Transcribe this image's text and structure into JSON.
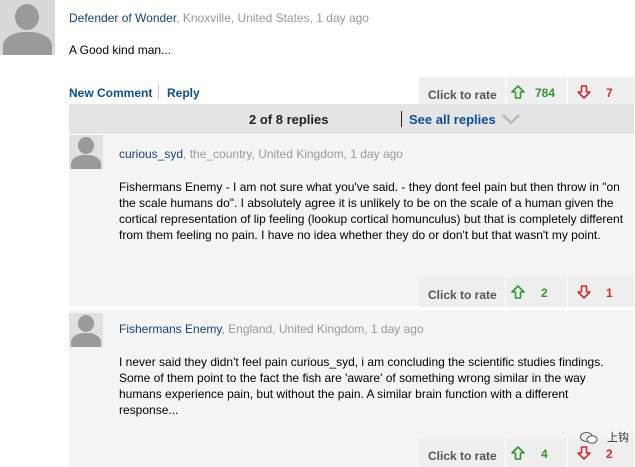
{
  "comment": {
    "author": "Defender of Wonder",
    "location": "Knoxville, United States",
    "time": "1 day ago",
    "body": "A Good kind man...",
    "actions": {
      "new_comment": "New Comment",
      "reply": "Reply",
      "rate_label": "Click to rate",
      "up_count": "784",
      "down_count": "7"
    }
  },
  "replies_header": {
    "count_text": "2 of 8 replies",
    "see_all": "See all replies"
  },
  "replies": [
    {
      "author": "curious_syd",
      "location": "the_country, United Kingdom",
      "time": "1 day ago",
      "body": "Fishermans Enemy - I am not sure what you've said. - they dont feel pain but then throw in \"on the scale humans do\". I absolutely agree it is unlikely to be on the scale of a human given the cortical representation of lip feeling (lookup cortical homunculus) but that is completely different from them feeling no pain. I have no idea whether they do or don't but that wasn't my point.",
      "rate_label": "Click to rate",
      "up_count": "2",
      "down_count": "1"
    },
    {
      "author": "Fishermans Enemy",
      "location": "England, United Kingdom",
      "time": "1 day ago",
      "body": "I never said they didn't feel pain curious_syd, i am concluding the scientific studies findings. Some of them point to the fact the fish are 'aware' of something wrong similar in the way humans experience pain, but without the pain. A similar brain function with a different response...",
      "rate_label": "Click to rate",
      "up_count": "4",
      "down_count": "2"
    }
  ],
  "watermark": {
    "text": "上钩"
  },
  "colors": {
    "author_link": "#14427a",
    "action_link": "#0a4f96",
    "up_vote": "#2d9a2d",
    "down_vote": "#d42b2b",
    "meta_text": "#999999"
  },
  "icons": [
    "user-avatar-icon",
    "thumb-up-arrow-icon",
    "thumb-down-arrow-icon",
    "chevron-down-icon",
    "wechat-logo-icon"
  ]
}
